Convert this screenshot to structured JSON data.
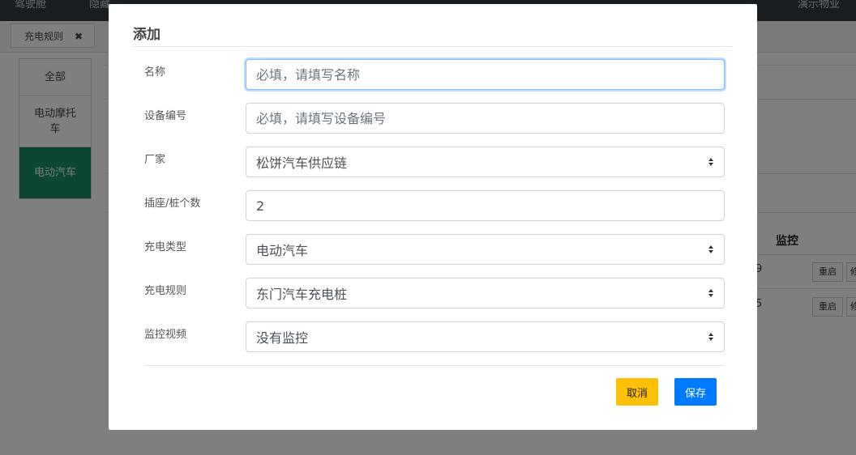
{
  "background": {
    "topbar": {
      "item1": "驾驶舱",
      "item2": "隐藏",
      "item3": "演示物业"
    },
    "tab": {
      "label": "充电规则",
      "close": "✖"
    },
    "sidebar": [
      {
        "label": "全部"
      },
      {
        "label": "电动摩托车"
      },
      {
        "label": "电动汽车"
      }
    ],
    "table": {
      "header": "监控",
      "rows": [
        {
          "num": "9",
          "btn": "重启",
          "btn2": "修"
        },
        {
          "num": "5",
          "btn": "重启",
          "btn2": "修"
        }
      ]
    }
  },
  "modal": {
    "title": "添加",
    "fields": {
      "name": {
        "label": "名称",
        "placeholder": "必填，请填写名称"
      },
      "device_no": {
        "label": "设备编号",
        "placeholder": "必填，请填写设备编号"
      },
      "vendor": {
        "label": "厂家",
        "value": "松饼汽车供应链"
      },
      "sockets": {
        "label": "插座/桩个数",
        "value": "2"
      },
      "charge_type": {
        "label": "充电类型",
        "value": "电动汽车"
      },
      "charge_rule": {
        "label": "充电规则",
        "value": "东门汽车充电桩"
      },
      "monitor_video": {
        "label": "监控视频",
        "value": "没有监控"
      }
    },
    "buttons": {
      "cancel": "取消",
      "save": "保存"
    }
  },
  "colors": {
    "cancel": "#ffc107",
    "save": "#007bff",
    "sidebar_active": "#1c8c6b"
  }
}
